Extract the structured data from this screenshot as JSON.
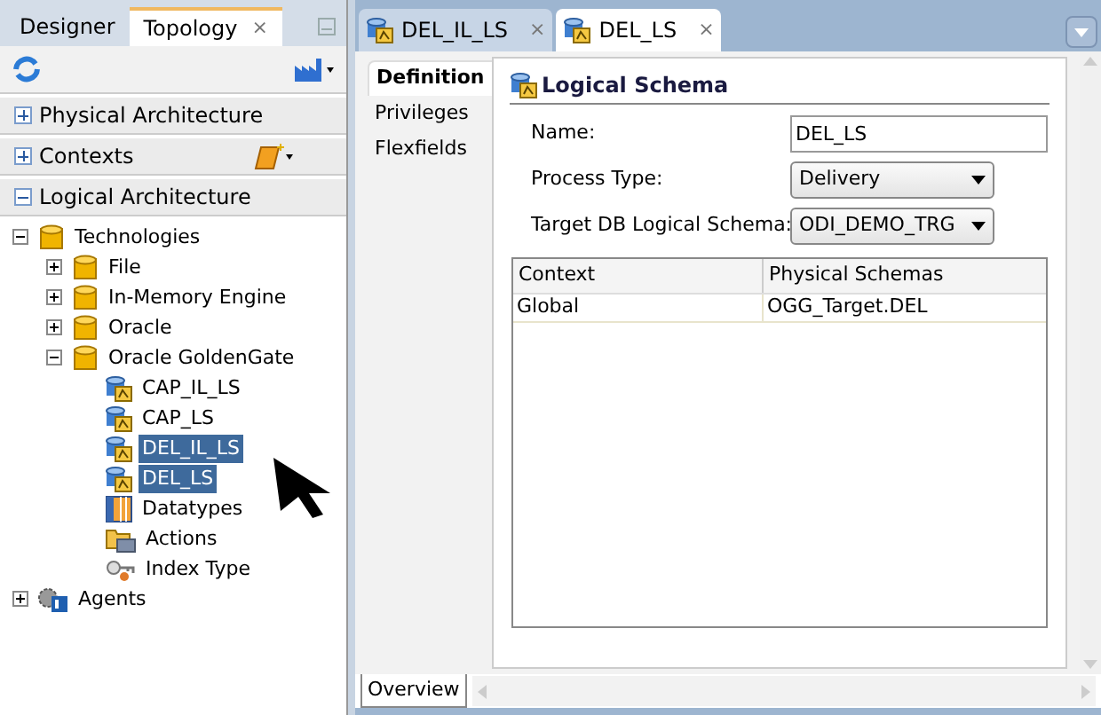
{
  "left_tabs": [
    {
      "label": "Designer",
      "selected": false
    },
    {
      "label": "Topology",
      "selected": true,
      "close": "×"
    }
  ],
  "accordion": [
    {
      "label": "Physical Architecture",
      "expanded": false
    },
    {
      "label": "Contexts",
      "expanded": false,
      "tool": true
    },
    {
      "label": "Logical Architecture",
      "expanded": true
    }
  ],
  "tree": [
    {
      "label": "Technologies",
      "kind": "db",
      "expanded": true,
      "selected": false,
      "children": [
        {
          "label": "File",
          "kind": "db",
          "expanded": false,
          "selected": false
        },
        {
          "label": "In-Memory Engine",
          "kind": "db",
          "expanded": false,
          "selected": false
        },
        {
          "label": "Oracle",
          "kind": "db",
          "expanded": false,
          "selected": false
        },
        {
          "label": "Oracle GoldenGate",
          "kind": "db",
          "expanded": true,
          "selected": false,
          "children": [
            {
              "label": "CAP_IL_LS",
              "kind": "schema",
              "selected": false
            },
            {
              "label": "CAP_LS",
              "kind": "schema",
              "selected": false
            },
            {
              "label": "DEL_IL_LS",
              "kind": "schema",
              "selected": true
            },
            {
              "label": "DEL_LS",
              "kind": "schema",
              "selected": true
            },
            {
              "label": "Datatypes",
              "kind": "datatypes",
              "selected": false
            },
            {
              "label": "Actions",
              "kind": "actions",
              "selected": false
            },
            {
              "label": "Index Type",
              "kind": "index",
              "selected": false
            }
          ]
        }
      ]
    },
    {
      "label": "Agents",
      "kind": "agent",
      "expanded": false,
      "selected": false
    }
  ],
  "editor_tabs": [
    {
      "label": "DEL_IL_LS",
      "selected": false,
      "close": "×"
    },
    {
      "label": "DEL_LS",
      "selected": true,
      "close": "×"
    }
  ],
  "side_tabs": [
    {
      "label": "Definition",
      "selected": true
    },
    {
      "label": "Privileges",
      "selected": false
    },
    {
      "label": "Flexfields",
      "selected": false
    }
  ],
  "section_title": "Logical Schema",
  "fields": [
    {
      "kind": "text",
      "label": "Name:",
      "value": "DEL_LS"
    },
    {
      "kind": "select",
      "label": "Process Type:",
      "value": "Delivery"
    },
    {
      "kind": "select",
      "label": "Target DB Logical Schema:",
      "value": "ODI_DEMO_TRG"
    }
  ],
  "table": {
    "columns": [
      "Context",
      "Physical Schemas"
    ],
    "rows": [
      [
        "Global",
        "OGG_Target.DEL"
      ]
    ]
  },
  "bottom_tabs": [
    {
      "label": "Overview",
      "selected": true
    }
  ]
}
